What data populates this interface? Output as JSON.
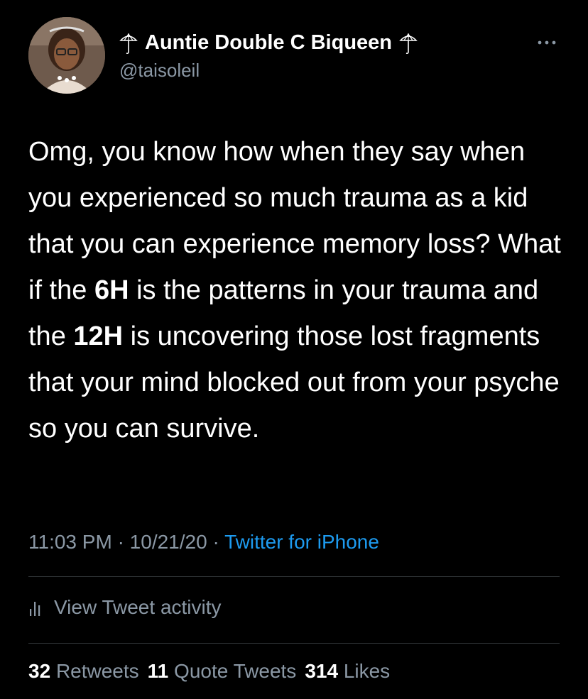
{
  "author": {
    "display_name": "Auntie Double C Biqueen",
    "handle": "@taisoleil",
    "name_emoji": "umbrella-icon"
  },
  "tweet": {
    "text_parts": [
      "Omg, you know how when they say when you experienced so much trauma as a kid that you can experience memory loss? What if the ",
      "6H",
      " is the patterns in your trauma and the ",
      "12H",
      " is uncovering those lost fragments that your mind blocked out from your psyche so you can survive."
    ]
  },
  "meta": {
    "time": "11:03 PM",
    "separator_1": "·",
    "date": "10/21/20",
    "separator_2": "·",
    "source": "Twitter for iPhone"
  },
  "activity": {
    "label": "View Tweet activity",
    "icon": "bar-chart-icon"
  },
  "stats": {
    "retweets_count": "32",
    "retweets_label": "Retweets",
    "quotes_count": "11",
    "quotes_label": "Quote Tweets",
    "likes_count": "314",
    "likes_label": "Likes"
  },
  "colors": {
    "background": "#000000",
    "primary_text": "#ffffff",
    "secondary_text": "#8b98a5",
    "link": "#1d9bf0",
    "divider": "#2f3336"
  }
}
